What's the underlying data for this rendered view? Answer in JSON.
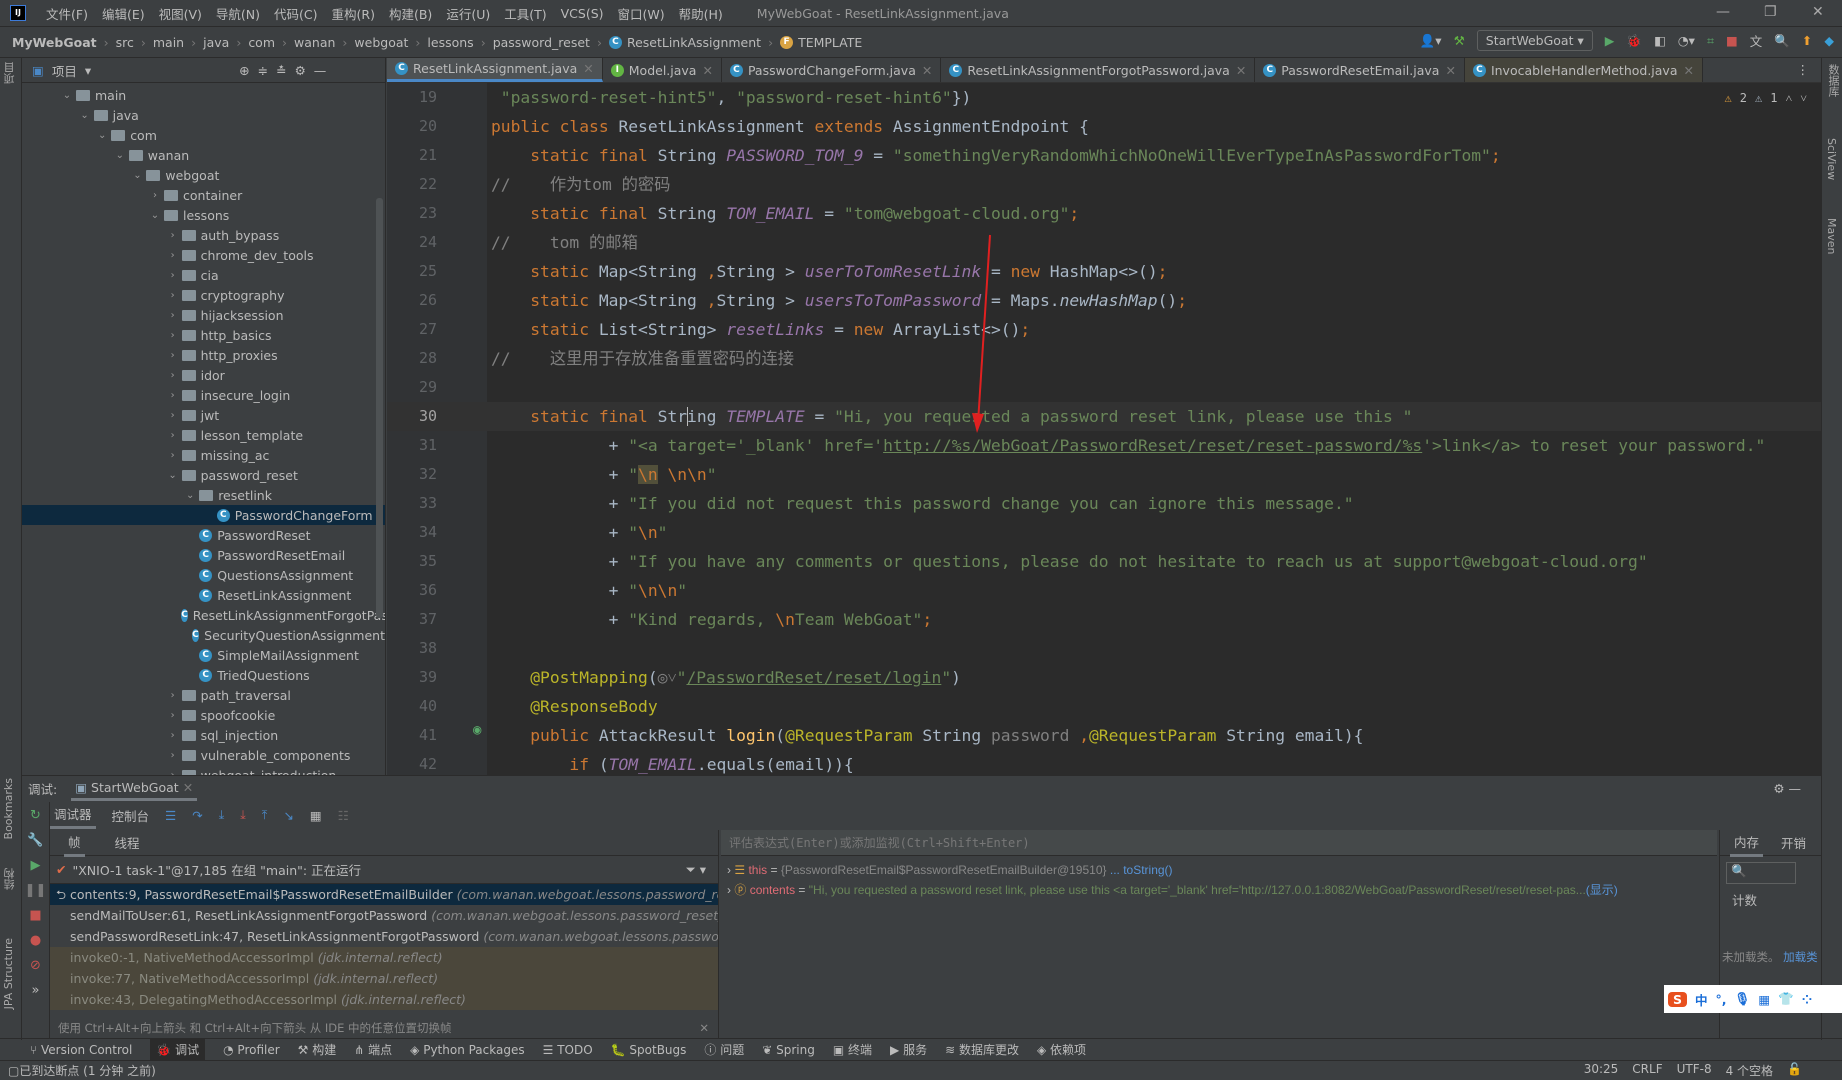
{
  "menubar": {
    "logo": "IJ",
    "items": [
      "文件(F)",
      "编辑(E)",
      "视图(V)",
      "导航(N)",
      "代码(C)",
      "重构(R)",
      "构建(B)",
      "运行(U)",
      "工具(T)",
      "VCS(S)",
      "窗口(W)",
      "帮助(H)"
    ],
    "title": "MyWebGoat - ResetLinkAssignment.java"
  },
  "breadcrumb": [
    "MyWebGoat",
    "src",
    "main",
    "java",
    "com",
    "wanan",
    "webgoat",
    "lessons",
    "password_reset",
    "ResetLinkAssignment",
    "TEMPLATE"
  ],
  "run_config": "StartWebGoat",
  "project": {
    "title": "项目",
    "items": [
      {
        "label": "main",
        "depth": 0,
        "type": "folder",
        "arrow": "open"
      },
      {
        "label": "java",
        "depth": 1,
        "type": "folder",
        "arrow": "open"
      },
      {
        "label": "com",
        "depth": 2,
        "type": "folder",
        "arrow": "open"
      },
      {
        "label": "wanan",
        "depth": 3,
        "type": "folder",
        "arrow": "open"
      },
      {
        "label": "webgoat",
        "depth": 4,
        "type": "folder",
        "arrow": "open"
      },
      {
        "label": "container",
        "depth": 5,
        "type": "folder",
        "arrow": "closed"
      },
      {
        "label": "lessons",
        "depth": 5,
        "type": "folder",
        "arrow": "open"
      },
      {
        "label": "auth_bypass",
        "depth": 6,
        "type": "folder",
        "arrow": "closed"
      },
      {
        "label": "chrome_dev_tools",
        "depth": 6,
        "type": "folder",
        "arrow": "closed"
      },
      {
        "label": "cia",
        "depth": 6,
        "type": "folder",
        "arrow": "closed"
      },
      {
        "label": "cryptography",
        "depth": 6,
        "type": "folder",
        "arrow": "closed"
      },
      {
        "label": "hijacksession",
        "depth": 6,
        "type": "folder",
        "arrow": "closed"
      },
      {
        "label": "http_basics",
        "depth": 6,
        "type": "folder",
        "arrow": "closed"
      },
      {
        "label": "http_proxies",
        "depth": 6,
        "type": "folder",
        "arrow": "closed"
      },
      {
        "label": "idor",
        "depth": 6,
        "type": "folder",
        "arrow": "closed"
      },
      {
        "label": "insecure_login",
        "depth": 6,
        "type": "folder",
        "arrow": "closed"
      },
      {
        "label": "jwt",
        "depth": 6,
        "type": "folder",
        "arrow": "closed"
      },
      {
        "label": "lesson_template",
        "depth": 6,
        "type": "folder",
        "arrow": "closed"
      },
      {
        "label": "missing_ac",
        "depth": 6,
        "type": "folder",
        "arrow": "closed"
      },
      {
        "label": "password_reset",
        "depth": 6,
        "type": "folder",
        "arrow": "open"
      },
      {
        "label": "resetlink",
        "depth": 7,
        "type": "folder",
        "arrow": "open"
      },
      {
        "label": "PasswordChangeForm",
        "depth": 8,
        "type": "class",
        "arrow": "none",
        "selected": true
      },
      {
        "label": "PasswordReset",
        "depth": 7,
        "type": "class",
        "arrow": "none"
      },
      {
        "label": "PasswordResetEmail",
        "depth": 7,
        "type": "class",
        "arrow": "none"
      },
      {
        "label": "QuestionsAssignment",
        "depth": 7,
        "type": "class",
        "arrow": "none"
      },
      {
        "label": "ResetLinkAssignment",
        "depth": 7,
        "type": "class",
        "arrow": "none"
      },
      {
        "label": "ResetLinkAssignmentForgotPassword",
        "depth": 7,
        "type": "class",
        "arrow": "none"
      },
      {
        "label": "SecurityQuestionAssignment",
        "depth": 7,
        "type": "class",
        "arrow": "none"
      },
      {
        "label": "SimpleMailAssignment",
        "depth": 7,
        "type": "class",
        "arrow": "none"
      },
      {
        "label": "TriedQuestions",
        "depth": 7,
        "type": "class",
        "arrow": "none"
      },
      {
        "label": "path_traversal",
        "depth": 6,
        "type": "folder",
        "arrow": "closed"
      },
      {
        "label": "spoofcookie",
        "depth": 6,
        "type": "folder",
        "arrow": "closed"
      },
      {
        "label": "sql_injection",
        "depth": 6,
        "type": "folder",
        "arrow": "closed"
      },
      {
        "label": "vulnerable_components",
        "depth": 6,
        "type": "folder",
        "arrow": "closed"
      },
      {
        "label": "webgoat_introduction",
        "depth": 6,
        "type": "folder",
        "arrow": "closed"
      }
    ]
  },
  "tabs": [
    {
      "label": "ResetLinkAssignment.java",
      "icon": "C",
      "active": true
    },
    {
      "label": "Model.java",
      "icon": "I"
    },
    {
      "label": "PasswordChangeForm.java",
      "icon": "C"
    },
    {
      "label": "ResetLinkAssignmentForgotPassword.java",
      "icon": "C"
    },
    {
      "label": "PasswordResetEmail.java",
      "icon": "C"
    },
    {
      "label": "InvocableHandlerMethod.java",
      "icon": "C"
    }
  ],
  "inspections": {
    "warnings": "2",
    "weak_warnings": "1"
  },
  "code": {
    "current_line": 30,
    "lines": [
      {
        "n": 19,
        "t": [
          [
            "str",
            " \"password-reset-hint5\""
          ],
          [
            "",
            ", "
          ],
          [
            "str",
            "\"password-reset-hint6\""
          ],
          [
            "",
            "})"
          ]
        ]
      },
      {
        "n": 20,
        "t": [
          [
            "kw",
            "public class "
          ],
          [
            "",
            "ResetLinkAssignment "
          ],
          [
            "kw",
            "extends "
          ],
          [
            "",
            "AssignmentEndpoint {"
          ]
        ]
      },
      {
        "n": 21,
        "t": [
          [
            "kw",
            "    static final "
          ],
          [
            "",
            "String "
          ],
          [
            "fld",
            "PASSWORD_TOM_9"
          ],
          [
            "",
            " = "
          ],
          [
            "str",
            "\"somethingVeryRandomWhichNoOneWillEverTypeInAsPasswordForTom\""
          ],
          [
            "kw",
            ";"
          ]
        ]
      },
      {
        "n": 22,
        "t": [
          [
            "cm",
            "//    作为tom 的密码"
          ]
        ]
      },
      {
        "n": 23,
        "t": [
          [
            "kw",
            "    static final "
          ],
          [
            "",
            "String "
          ],
          [
            "fld",
            "TOM_EMAIL"
          ],
          [
            "",
            " = "
          ],
          [
            "str",
            "\"tom@webgoat-cloud.org\""
          ],
          [
            "kw",
            ";"
          ]
        ]
      },
      {
        "n": 24,
        "t": [
          [
            "cm",
            "//    tom 的邮箱"
          ]
        ]
      },
      {
        "n": 25,
        "t": [
          [
            "kw",
            "    static "
          ],
          [
            "",
            "Map<String "
          ],
          [
            "kw",
            ","
          ],
          [
            "",
            "String > "
          ],
          [
            "fld",
            "userToTomResetLink"
          ],
          [
            "",
            " = "
          ],
          [
            "kw",
            "new "
          ],
          [
            "",
            "HashMap<>()"
          ],
          [
            "kw",
            ";"
          ]
        ]
      },
      {
        "n": 26,
        "t": [
          [
            "kw",
            "    static "
          ],
          [
            "",
            "Map<String "
          ],
          [
            "kw",
            ","
          ],
          [
            "",
            "String > "
          ],
          [
            "fld",
            "usersToTomPassword"
          ],
          [
            "",
            " = Maps."
          ],
          [
            "it",
            "newHashMap"
          ],
          [
            "",
            "()"
          ],
          [
            "kw",
            ";"
          ]
        ]
      },
      {
        "n": 27,
        "t": [
          [
            "kw",
            "    static "
          ],
          [
            "",
            "List<String> "
          ],
          [
            "fld",
            "resetLinks"
          ],
          [
            "",
            " = "
          ],
          [
            "kw",
            "new "
          ],
          [
            "",
            "ArrayList<>()"
          ],
          [
            "kw",
            ";"
          ]
        ]
      },
      {
        "n": 28,
        "t": [
          [
            "cm",
            "//    这里用于存放准备重置密码的连接"
          ]
        ]
      },
      {
        "n": 29,
        "t": []
      },
      {
        "n": 30,
        "t": [
          [
            "kw",
            "    static final "
          ],
          [
            "",
            "String "
          ],
          [
            "fld",
            "TEMPLATE"
          ],
          [
            "",
            " = "
          ],
          [
            "str",
            "\"Hi, you requested a password reset link, please use this \""
          ]
        ]
      },
      {
        "n": 31,
        "t": [
          [
            "",
            "            + "
          ],
          [
            "str",
            "\"<a target='_blank' href='"
          ],
          [
            "lnk",
            "http://%s/WebGoat/PasswordReset/reset/reset-password/%s"
          ],
          [
            "str",
            "'>link</a> to reset your password.\""
          ]
        ]
      },
      {
        "n": 32,
        "t": [
          [
            "",
            "            + "
          ],
          [
            "str",
            "\""
          ],
          [
            "escb",
            "\\n"
          ],
          [
            "str",
            " "
          ],
          [
            "esc",
            "\\n\\n"
          ],
          [
            "str",
            "\""
          ]
        ]
      },
      {
        "n": 33,
        "t": [
          [
            "",
            "            + "
          ],
          [
            "str",
            "\"If you did not request this password change you can ignore this message.\""
          ]
        ]
      },
      {
        "n": 34,
        "t": [
          [
            "",
            "            + "
          ],
          [
            "str",
            "\""
          ],
          [
            "esc",
            "\\n"
          ],
          [
            "str",
            "\""
          ]
        ]
      },
      {
        "n": 35,
        "t": [
          [
            "",
            "            + "
          ],
          [
            "str",
            "\"If you have any comments or questions, please do not hesitate to reach us at support@webgoat-cloud.org\""
          ]
        ]
      },
      {
        "n": 36,
        "t": [
          [
            "",
            "            + "
          ],
          [
            "str",
            "\""
          ],
          [
            "esc",
            "\\n\\n"
          ],
          [
            "str",
            "\""
          ]
        ]
      },
      {
        "n": 37,
        "t": [
          [
            "",
            "            + "
          ],
          [
            "str",
            "\"Kind regards, "
          ],
          [
            "esc",
            "\\n"
          ],
          [
            "str",
            "Team WebGoat\""
          ],
          [
            "kw",
            ";"
          ]
        ]
      },
      {
        "n": 38,
        "t": []
      },
      {
        "n": 39,
        "t": [
          [
            "ann",
            "    @PostMapping"
          ],
          [
            "",
            "("
          ],
          [
            "cm",
            "◎˅"
          ],
          [
            "str",
            "\""
          ],
          [
            "lnk",
            "/PasswordReset/reset/login"
          ],
          [
            "str",
            "\""
          ],
          [
            "",
            ")"
          ]
        ]
      },
      {
        "n": 40,
        "t": [
          [
            "ann",
            "    @ResponseBody"
          ]
        ]
      },
      {
        "n": 41,
        "t": [
          [
            "kw",
            "    public "
          ],
          [
            "",
            "AttackResult "
          ],
          [
            "fn",
            "login"
          ],
          [
            "",
            "("
          ],
          [
            "ann",
            "@RequestParam "
          ],
          [
            "",
            "String "
          ],
          [
            "cm",
            "password "
          ],
          [
            "kw",
            ","
          ],
          [
            "ann",
            "@RequestParam "
          ],
          [
            "",
            "String email){"
          ]
        ]
      },
      {
        "n": 42,
        "t": [
          [
            "kw",
            "        if "
          ],
          [
            "",
            "("
          ],
          [
            "fld",
            "TOM_EMAIL"
          ],
          [
            "",
            "."
          ],
          [
            "",
            "equals(email)){"
          ]
        ]
      }
    ]
  },
  "debug": {
    "label": "调试:",
    "session": "StartWebGoat",
    "tabs": [
      "调试器",
      "控制台"
    ],
    "subtabs": [
      "帧",
      "线程"
    ],
    "thread": "\"XNIO-1 task-1\"@17,185 在组 \"main\": 正在运行",
    "frames": [
      {
        "method": "contents:9, PasswordResetEmail$PasswordResetEmailBuilder",
        "pkg": "(com.wanan.webgoat.lessons.password_reset)",
        "kind": "selected"
      },
      {
        "method": "sendMailToUser:61, ResetLinkAssignmentForgotPassword",
        "pkg": "(com.wanan.webgoat.lessons.password_reset)",
        "kind": "user"
      },
      {
        "method": "sendPasswordResetLink:47, ResetLinkAssignmentForgotPassword",
        "pkg": "(com.wanan.webgoat.lessons.password_reset)",
        "kind": "user"
      },
      {
        "method": "invoke0:-1, NativeMethodAccessorImpl",
        "pkg": "(jdk.internal.reflect)",
        "kind": "lib"
      },
      {
        "method": "invoke:77, NativeMethodAccessorImpl",
        "pkg": "(jdk.internal.reflect)",
        "kind": "lib"
      },
      {
        "method": "invoke:43, DelegatingMethodAccessorImpl",
        "pkg": "(jdk.internal.reflect)",
        "kind": "lib"
      }
    ],
    "hint": "使用 Ctrl+Alt+向上箭头 和 Ctrl+Alt+向下箭头 从 IDE 中的任意位置切换帧",
    "eval_placeholder": "评估表达式(Enter)或添加监视(Ctrl+Shift+Enter)",
    "vars": {
      "this_name": "this",
      "this_value": "{PasswordResetEmail$PasswordResetEmailBuilder@19510}",
      "this_link": "... toString()",
      "contents_name": "contents",
      "contents_value": "\"Hi, you requested a password reset link, please use this <a target='_blank' href='http://127.0.0.1:8082/WebGoat/PasswordReset/reset/reset-pas...",
      "contents_link": "(显示)"
    },
    "memory": {
      "tabs": [
        "内存",
        "开销"
      ],
      "column": "计数",
      "empty": "未加载类。",
      "load_link": "加载类"
    }
  },
  "toolwindows": [
    "Version Control",
    "调试",
    "Profiler",
    "构建",
    "端点",
    "Python Packages",
    "TODO",
    "SpotBugs",
    "问题",
    "Spring",
    "终端",
    "服务",
    "数据库更改",
    "依赖项"
  ],
  "sidebar_left": [
    "项目",
    "Bookmarks",
    "结构",
    "JPA Structure"
  ],
  "sidebar_right": [
    "数据库",
    "SciView",
    "Maven"
  ],
  "status": {
    "message": "已到达断点 (1 分钟 之前)",
    "position": "30:25",
    "line_sep": "CRLF",
    "encoding": "UTF-8",
    "indent": "4 个空格"
  },
  "ime": {
    "label": "中"
  }
}
